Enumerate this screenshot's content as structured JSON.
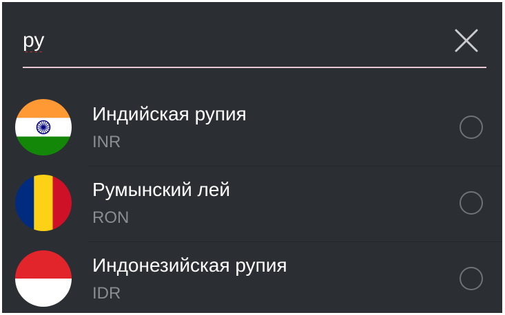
{
  "search": {
    "value": "ру"
  },
  "currencies": [
    {
      "name": "Индийская рупия",
      "code": "INR",
      "flag": "india-flag-icon"
    },
    {
      "name": "Румынский лей",
      "code": "RON",
      "flag": "romania-flag-icon"
    },
    {
      "name": "Индонезийская рупия",
      "code": "IDR",
      "flag": "indonesia-flag-icon"
    }
  ],
  "colors": {
    "background": "#2b2e33",
    "primary_text": "#ffffff",
    "secondary_text": "#8a8d92",
    "search_underline": "#e8c9cf",
    "radio_outline": "#6f7277"
  }
}
